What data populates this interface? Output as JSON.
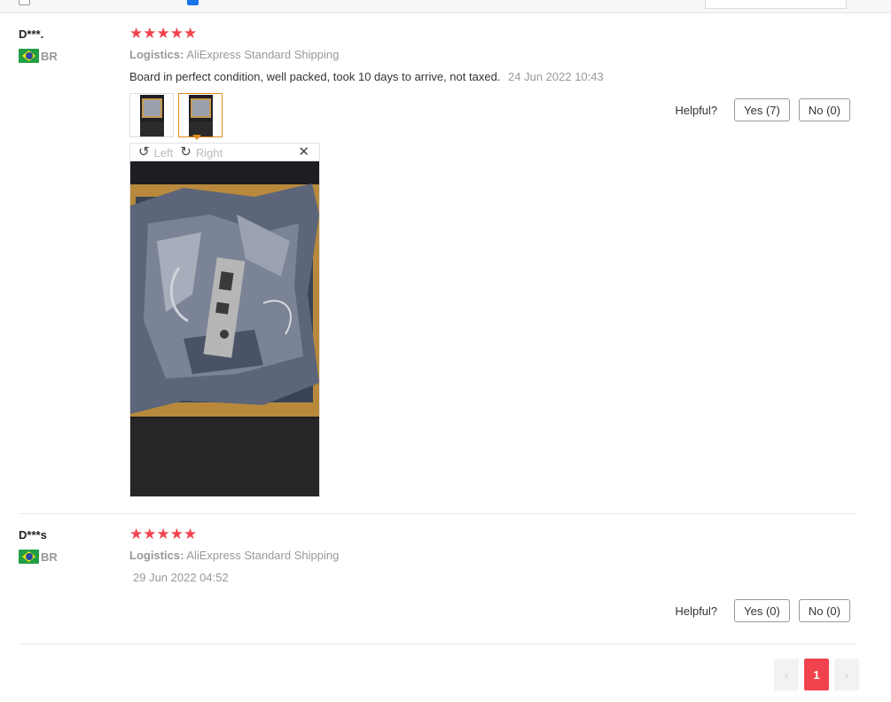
{
  "reviews": [
    {
      "user": "D***.",
      "country": "BR",
      "stars": "★★★★★",
      "logistics_label": "Logistics:",
      "logistics_value": "AliExpress Standard Shipping",
      "text": "Board in perfect condition, well packed, took 10 days to arrive, not taxed.",
      "date": "24 Jun 2022 10:43",
      "helpful": {
        "label": "Helpful?",
        "yes": "Yes (7)",
        "no": "No (0)"
      },
      "viewer": {
        "left": "Left",
        "right": "Right",
        "close": "✕"
      }
    },
    {
      "user": "D***s",
      "country": "BR",
      "stars": "★★★★★",
      "logistics_label": "Logistics:",
      "logistics_value": "AliExpress Standard Shipping",
      "date": "29 Jun 2022 04:52",
      "helpful": {
        "label": "Helpful?",
        "yes": "Yes (0)",
        "no": "No (0)"
      }
    }
  ],
  "pagination": {
    "prev": "‹",
    "current": "1",
    "next": "›"
  },
  "colors": {
    "star": "#f0434e",
    "accent": "#e08a1e",
    "page_active": "#f0434e"
  }
}
